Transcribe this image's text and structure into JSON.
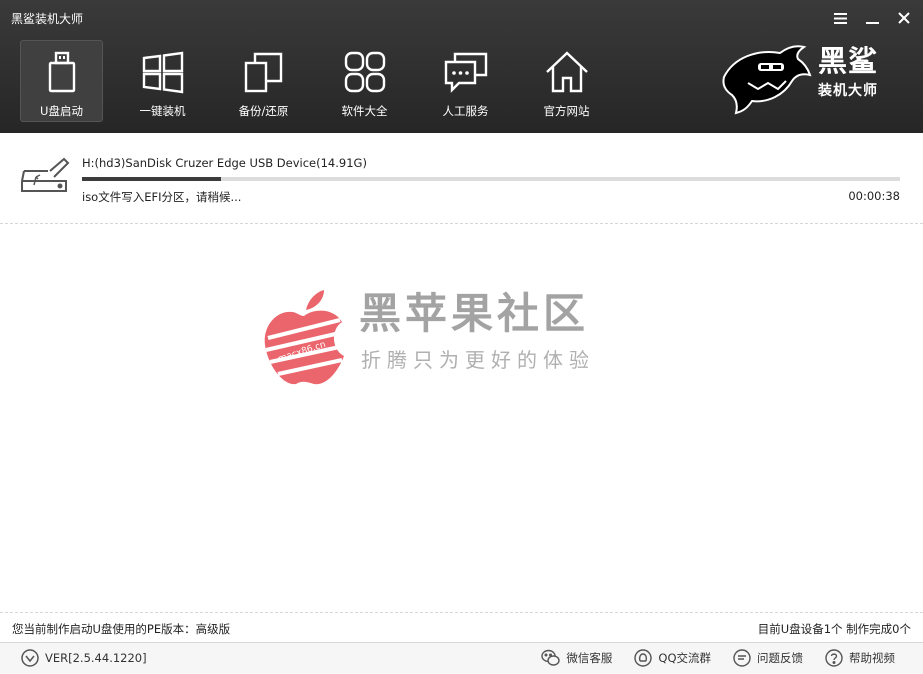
{
  "window": {
    "title": "黑鲨装机大师"
  },
  "nav": {
    "items": [
      {
        "label": "U盘启动",
        "icon": "usb-drive-icon"
      },
      {
        "label": "一键装机",
        "icon": "windows-icon"
      },
      {
        "label": "备份/还原",
        "icon": "backup-restore-icon"
      },
      {
        "label": "软件大全",
        "icon": "apps-grid-icon"
      },
      {
        "label": "人工服务",
        "icon": "chat-bubble-icon"
      },
      {
        "label": "官方网站",
        "icon": "home-icon"
      }
    ]
  },
  "brand": {
    "main": "黑鲨",
    "sub": "装机大师"
  },
  "device": {
    "name": "H:(hd3)SanDisk Cruzer Edge USB Device(14.91G)",
    "status": "iso文件写入EFI分区，请稍候...",
    "elapsed": "00:00:38",
    "progress": 0.17
  },
  "watermark": {
    "title": "黑苹果社区",
    "subtitle": "折腾只为更好的体验",
    "badge": "macx86.cn"
  },
  "info": {
    "pe_version": "您当前制作启动U盘使用的PE版本：高级版",
    "device_count": "目前U盘设备1个 制作完成0个"
  },
  "footer": {
    "version": "VER[2.5.44.1220]",
    "links": [
      {
        "label": "微信客服",
        "icon": "wechat-icon"
      },
      {
        "label": "QQ交流群",
        "icon": "qq-icon"
      },
      {
        "label": "问题反馈",
        "icon": "feedback-icon"
      },
      {
        "label": "帮助视频",
        "icon": "help-icon"
      }
    ]
  },
  "colors": {
    "header_bg": "#2e2e2e",
    "active_tab": "#404040",
    "progress": "#3c3c3c",
    "watermark_red": "#e9555d"
  }
}
